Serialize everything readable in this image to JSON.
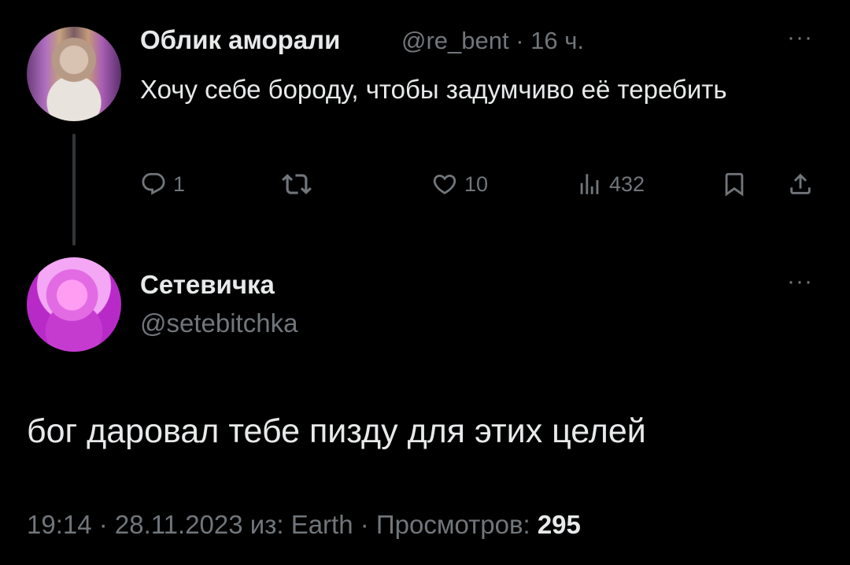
{
  "tweet1": {
    "author_name": "Облик аморали",
    "handle_time": "@re_bent · 16 ч.",
    "text": "Хочу себе бороду, чтобы задумчиво её теребить",
    "more": "···",
    "actions": {
      "reply_count": "1",
      "retweet_count": "",
      "like_count": "10",
      "views_count": "432"
    }
  },
  "tweet2": {
    "author_name": "Сетевичка",
    "handle": "@setebitchka",
    "more": "···",
    "text": "бог даровал тебе пизду для этих целей",
    "meta_prefix": "19:14 · 28.11.2023 из: Earth · Просмотров: ",
    "views": "295"
  },
  "colors": {
    "background": "#000000",
    "primary_text": "#e7e9ea",
    "secondary_text": "#71767b",
    "thread_line": "#333639"
  },
  "icons": [
    "reply-icon",
    "retweet-icon",
    "like-icon",
    "views-icon",
    "bookmark-icon",
    "share-icon",
    "more-icon"
  ]
}
